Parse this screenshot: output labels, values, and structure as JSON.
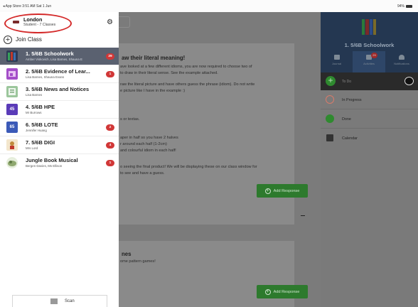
{
  "status_bar": {
    "left": "◂ App Store  3:51 AM  Sat 1 Jun",
    "right": "94%"
  },
  "account": {
    "name": "London",
    "subtitle": "Student - 7 Classes"
  },
  "join_class": "Join Class",
  "classes": [
    {
      "name": "1. 5/6B Schoolwork",
      "teachers": "Amber Viskovich, Lisa Barnes, Shauna E",
      "badge": "29",
      "avatar_text": "",
      "color": "#3b6fb0",
      "active": true
    },
    {
      "name": "2. 5/6B Evidence of Lear...",
      "teachers": "Lisa Barnes, Shauna Evans",
      "badge": "1",
      "avatar_text": "",
      "color": "#a44ec9",
      "active": false
    },
    {
      "name": "3. 5/6B News and Notices",
      "teachers": "Lisa Barnes",
      "badge": "",
      "avatar_text": "",
      "color": "#8fbf8f",
      "active": false
    },
    {
      "name": "4. 5/6B HPE",
      "teachers": "Mr Burrows",
      "badge": "",
      "avatar_text": "45",
      "color": "#5a3bb8",
      "active": false
    },
    {
      "name": "6. 5/6B LOTE",
      "teachers": "Jennifer Huang",
      "badge": "2",
      "avatar_text": "65",
      "color": "#3b5ab8",
      "active": false
    },
    {
      "name": "7. 5/6B DIGI",
      "teachers": "Mrs Lord",
      "badge": "4",
      "avatar_text": "",
      "color": "#c08a3b",
      "active": false
    },
    {
      "name": "Jungle Book Musical",
      "teachers": "Bergen Davies, Ms Ellison",
      "badge": "1",
      "avatar_text": "",
      "color": "#8fa86f",
      "active": false
    }
  ],
  "scan": "Scan",
  "main": {
    "post1": {
      "title": "aw their literal meaning!",
      "lines": [
        "ave looked at a few different idioms, you are now required to choose two of",
        "to draw in their literal sense. See the example attached.",
        "",
        "raw the literal picture and have others guess the phrase (idiom). Do not write",
        "e picture like I have in the example :)",
        "",
        "s or textas.",
        "",
        "aper in half so you have 2 halves",
        "r around each half (1-2cm)",
        " and colourful idiom in each half!",
        "",
        "o seeing the final product! We will be displaying these on our class window for",
        "to see and have a guess."
      ],
      "add_response": "Add Response"
    },
    "post2": {
      "title": "nes",
      "lines": [
        "ome pattern games!"
      ],
      "add_response": "Add Response"
    }
  },
  "right_panel": {
    "class_title": "1. 5/6B Schoolwork",
    "tabs": [
      {
        "label": "Journal",
        "badge": ""
      },
      {
        "label": "Activities",
        "badge": "29"
      },
      {
        "label": "Notifications",
        "badge": ""
      }
    ],
    "todo": "To Do",
    "rows": [
      {
        "label": "In Progress",
        "color": "#d97a6a"
      },
      {
        "label": "Done",
        "color": "#2f8a2f"
      },
      {
        "label": "Calendar",
        "color": "#333333"
      }
    ]
  }
}
